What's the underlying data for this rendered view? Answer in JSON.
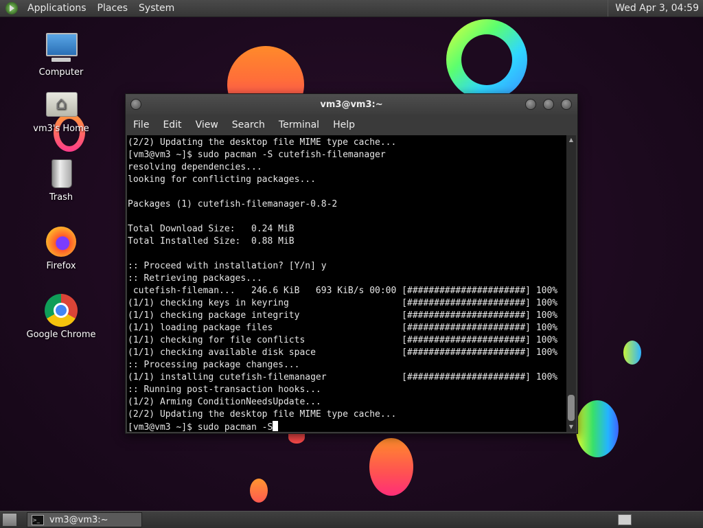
{
  "top_panel": {
    "menus": [
      "Applications",
      "Places",
      "System"
    ],
    "clock": "Wed Apr 3, 04:59"
  },
  "desktop_icons": [
    {
      "label": "Computer",
      "icon": "computer-icon"
    },
    {
      "label": "vm3's Home",
      "icon": "home-folder-icon"
    },
    {
      "label": "Trash",
      "icon": "trash-icon"
    },
    {
      "label": "Firefox",
      "icon": "firefox-icon"
    },
    {
      "label": "Google Chrome",
      "icon": "chrome-icon"
    }
  ],
  "terminal": {
    "title": "vm3@vm3:~",
    "menus": [
      "File",
      "Edit",
      "View",
      "Search",
      "Terminal",
      "Help"
    ],
    "lines": [
      "(2/2) Updating the desktop file MIME type cache...",
      "[vm3@vm3 ~]$ sudo pacman -S cutefish-filemanager",
      "resolving dependencies...",
      "looking for conflicting packages...",
      "",
      "Packages (1) cutefish-filemanager-0.8-2",
      "",
      "Total Download Size:   0.24 MiB",
      "Total Installed Size:  0.88 MiB",
      "",
      ":: Proceed with installation? [Y/n] y",
      ":: Retrieving packages...",
      " cutefish-fileman...   246.6 KiB   693 KiB/s 00:00 [######################] 100%",
      "(1/1) checking keys in keyring                     [######################] 100%",
      "(1/1) checking package integrity                   [######################] 100%",
      "(1/1) loading package files                        [######################] 100%",
      "(1/1) checking for file conflicts                  [######################] 100%",
      "(1/1) checking available disk space                [######################] 100%",
      ":: Processing package changes...",
      "(1/1) installing cutefish-filemanager              [######################] 100%",
      ":: Running post-transaction hooks...",
      "(1/2) Arming ConditionNeedsUpdate...",
      "(2/2) Updating the desktop file MIME type cache..."
    ],
    "prompt_line": "[vm3@vm3 ~]$ sudo pacman -S"
  },
  "taskbar": {
    "tasks": [
      {
        "label": "vm3@vm3:~",
        "icon": "terminal-icon"
      }
    ]
  },
  "colors": {
    "desktop_bg": "#1d0a1f",
    "panel_bg": "#3c3c3c",
    "terminal_bg": "#000000",
    "terminal_fg": "#e6e6e6"
  }
}
